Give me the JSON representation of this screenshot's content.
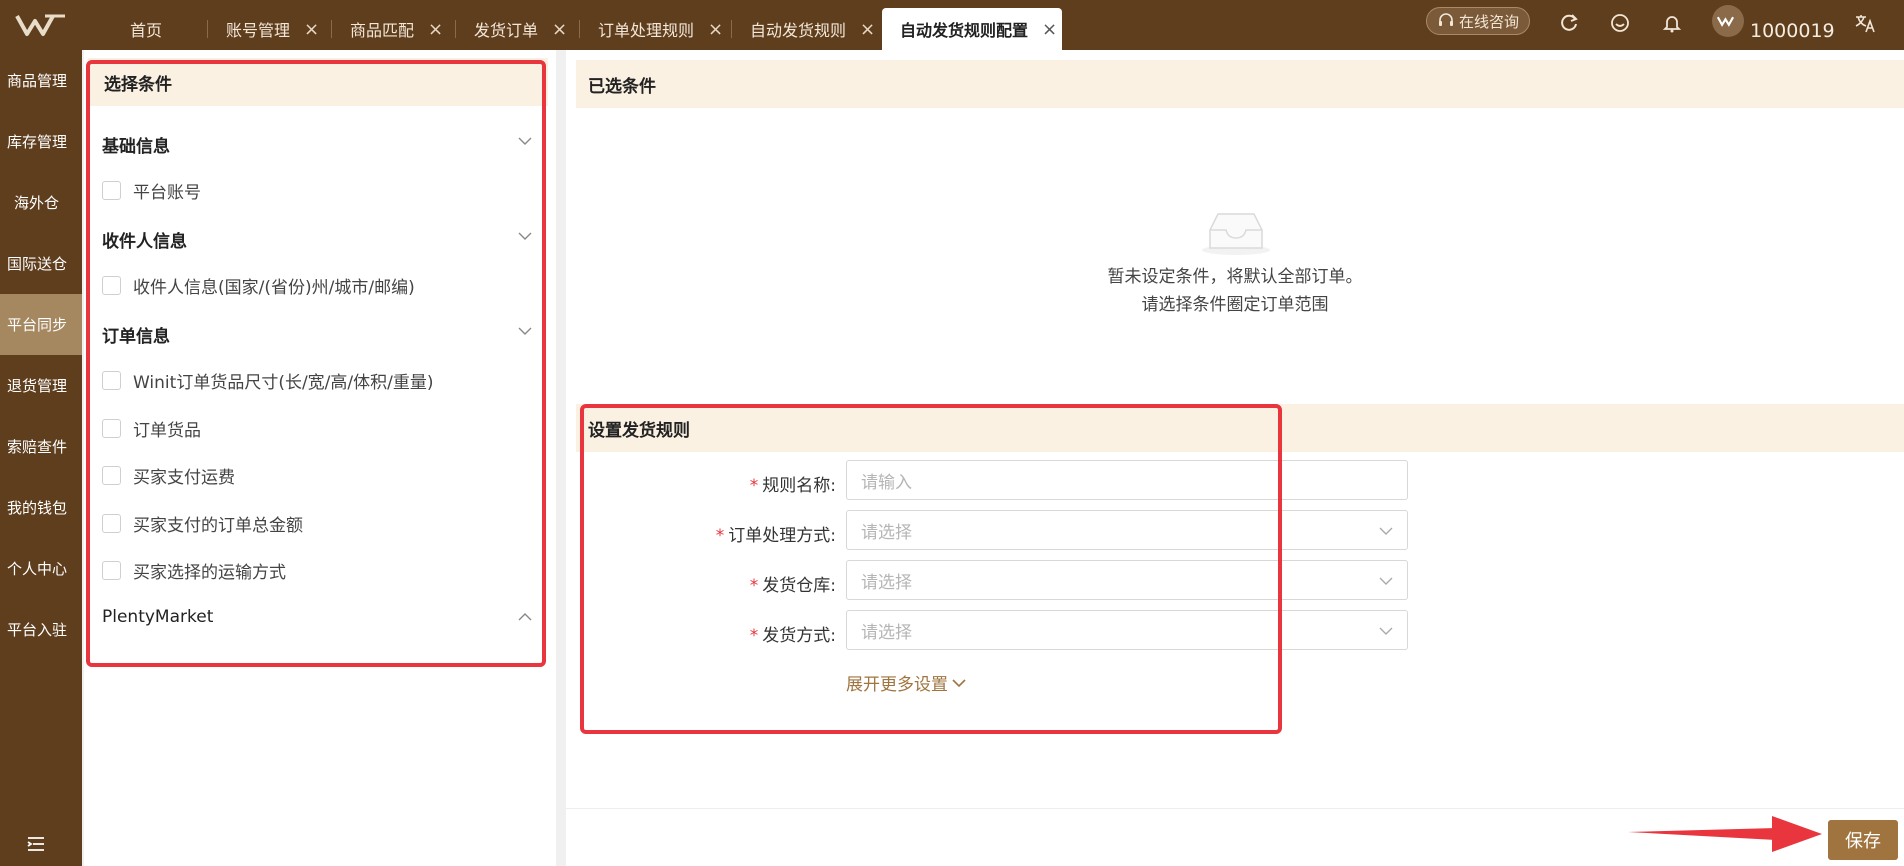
{
  "topbar": {
    "tabs": [
      {
        "label": "首页",
        "closable": false
      },
      {
        "label": "账号管理",
        "closable": true
      },
      {
        "label": "商品匹配",
        "closable": true
      },
      {
        "label": "发货订单",
        "closable": true
      },
      {
        "label": "订单处理规则",
        "closable": true
      },
      {
        "label": "自动发货规则",
        "closable": true
      },
      {
        "label": "自动发货规则配置",
        "closable": true,
        "active": true
      }
    ],
    "close_glyph": "×",
    "consult_label": "在线咨询",
    "user_id": "1000019",
    "icons": [
      "refresh-icon",
      "smile-icon",
      "bell-icon",
      "translate-icon"
    ]
  },
  "sidebar": {
    "items": [
      {
        "label": "商品管理"
      },
      {
        "label": "库存管理"
      },
      {
        "label": "海外仓"
      },
      {
        "label": "国际送仓"
      },
      {
        "label": "平台同步",
        "active": true
      },
      {
        "label": "退货管理"
      },
      {
        "label": "索赔查件"
      },
      {
        "label": "我的钱包"
      },
      {
        "label": "个人中心"
      },
      {
        "label": "平台入驻"
      }
    ]
  },
  "conditions": {
    "title": "选择条件",
    "groups": [
      {
        "title": "基础信息",
        "items": [
          "平台账号"
        ]
      },
      {
        "title": "收件人信息",
        "items": [
          "收件人信息(国家/(省份)州/城市/邮编)"
        ]
      },
      {
        "title": "订单信息",
        "items": [
          "Winit订单货品尺寸(长/宽/高/体积/重量)",
          "订单货品",
          "买家支付运费",
          "买家支付的订单总金额",
          "买家选择的运输方式"
        ]
      }
    ],
    "extra_group": "PlentyMarket"
  },
  "selected": {
    "title": "已选条件",
    "empty_line1": "暂未设定条件，将默认全部订单。",
    "empty_line2": "请选择条件圈定订单范围"
  },
  "rule_form": {
    "title": "设置发货规则",
    "required_mark": "*",
    "fields": [
      {
        "label": "规则名称:",
        "placeholder": "请输入",
        "type": "input"
      },
      {
        "label": "订单处理方式:",
        "placeholder": "请选择",
        "type": "select"
      },
      {
        "label": "发货仓库:",
        "placeholder": "请选择",
        "type": "select"
      },
      {
        "label": "发货方式:",
        "placeholder": "请选择",
        "type": "select"
      }
    ],
    "expand_label": "展开更多设置"
  },
  "actions": {
    "save_label": "保存"
  },
  "colors": {
    "brand_dark": "#5f3e1e",
    "brand_accent": "#a0743f",
    "sidebar_active": "#a58760",
    "header_bg": "#fbf1e3",
    "highlight_red": "#e8353e"
  }
}
